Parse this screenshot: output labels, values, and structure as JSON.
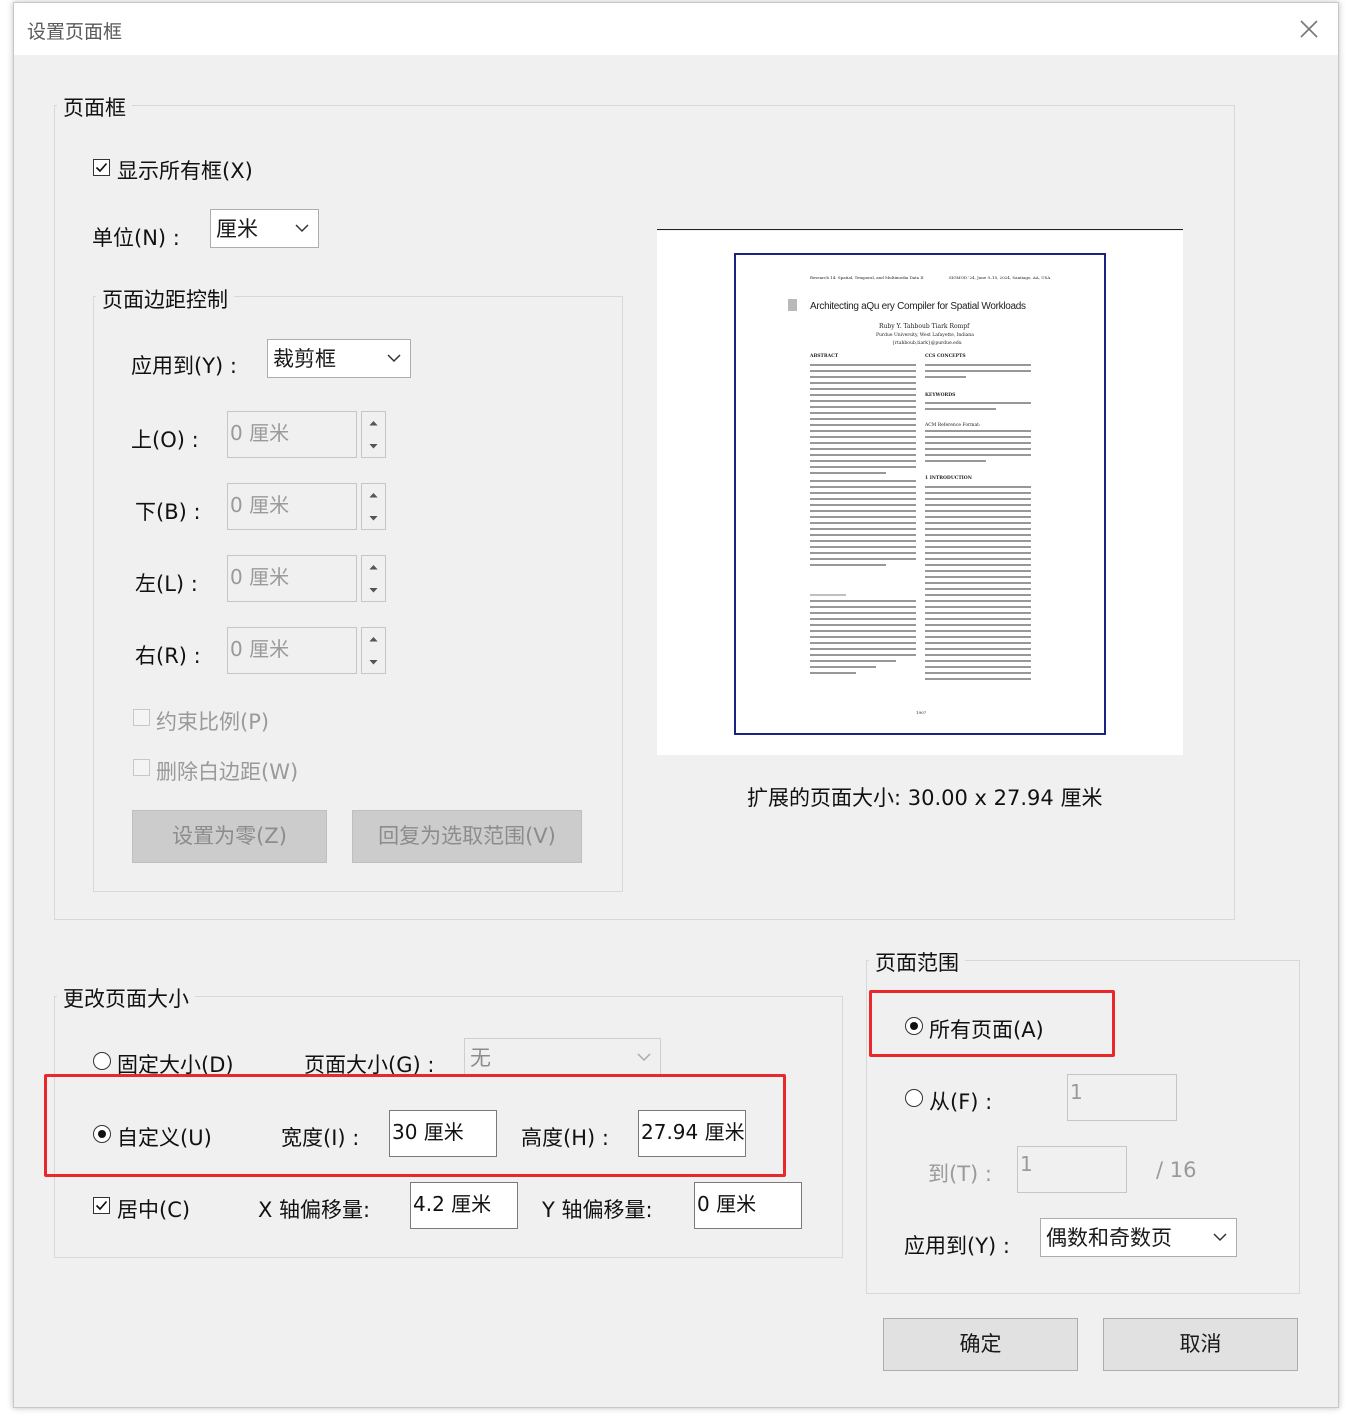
{
  "dialog": {
    "title": "设置页面框"
  },
  "page_boxes": {
    "legend": "页面框",
    "show_all_boxes": {
      "label": "显示所有框(X)",
      "checked": true
    },
    "unit": {
      "label": "单位(N) :",
      "value": "厘米"
    },
    "margin_controls": {
      "legend": "页面边距控制",
      "apply_to": {
        "label": "应用到(Y) :",
        "value": "裁剪框"
      },
      "top": {
        "label": "上(O) :",
        "value": "0 厘米"
      },
      "bottom": {
        "label": "下(B) :",
        "value": "0 厘米"
      },
      "left": {
        "label": "左(L) :",
        "value": "0 厘米"
      },
      "right": {
        "label": "右(R) :",
        "value": "0 厘米"
      },
      "constrain": {
        "label": "约束比例(P)",
        "checked": false
      },
      "remove_white": {
        "label": "删除白边距(W)",
        "checked": false
      },
      "set_zero_button": "设置为零(Z)",
      "revert_button": "回复为选取范围(V)"
    },
    "preview": {
      "header_left": "Research 14: Spatial, Temporal, and Multimedia Data II",
      "header_right": "SIGMOD '24, June 9–15, 2024, Santiago, AA, USA",
      "paper_title": "Architecting aQu ery Compiler for Spatial Workloads",
      "authors": "Ruby Y. Tahboub   Tiark Rompf",
      "affiliation": "Purdue University, West Lafayette, Indiana",
      "email": "{rtahboub,tiark}@purdue.edu",
      "abstract_heading": "ABSTRACT",
      "ccs_heading": "CCS CONCEPTS",
      "keywords_heading": "KEYWORDS",
      "acm_heading": "ACM Reference Format:",
      "intro_heading": "1   INTRODUCTION",
      "page_number": "1907"
    },
    "expanded_size": "扩展的页面大小:  30.00 x 27.94 厘米"
  },
  "change_size": {
    "legend": "更改页面大小",
    "fixed": {
      "label": "固定大小(D)",
      "selected": false
    },
    "page_size": {
      "label": "页面大小(G) :",
      "value": "无"
    },
    "custom": {
      "label": "自定义(U)",
      "selected": true
    },
    "width": {
      "label": "宽度(I) :",
      "value": "30 厘米"
    },
    "height": {
      "label": "高度(H) :",
      "value": "27.94 厘米"
    },
    "center": {
      "label": "居中(C)",
      "checked": true
    },
    "x_offset": {
      "label": "X 轴偏移量:",
      "value": "4.2 厘米"
    },
    "y_offset": {
      "label": "Y 轴偏移量:",
      "value": "0 厘米"
    }
  },
  "page_range": {
    "legend": "页面范围",
    "all": {
      "label": "所有页面(A)",
      "selected": true
    },
    "from": {
      "label": "从(F) :",
      "value": "1",
      "selected": false
    },
    "to": {
      "label": "到(T) :",
      "value": "1",
      "total": "/ 16"
    },
    "apply_to": {
      "label": "应用到(Y) :",
      "value": "偶数和奇数页"
    }
  },
  "buttons": {
    "ok": "确定",
    "cancel": "取消"
  },
  "colors": {
    "highlight": "#e8282b",
    "page_border": "#1a2380",
    "dialog_bg": "#f0f0f0"
  }
}
